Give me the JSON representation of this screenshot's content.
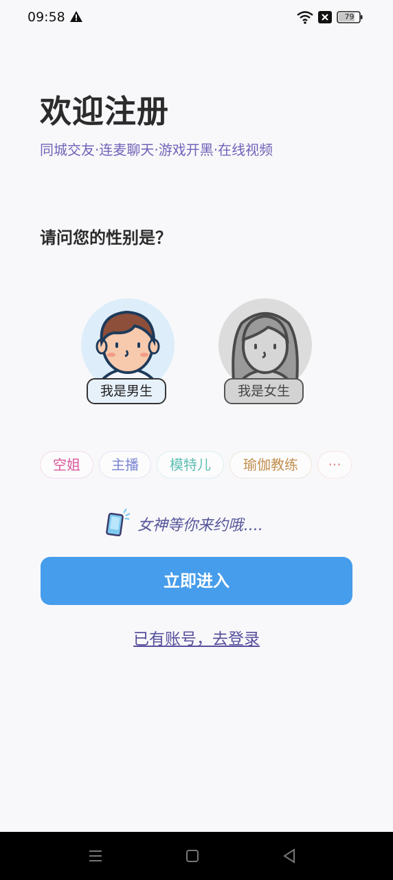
{
  "status_bar": {
    "time": "09:58",
    "battery": "79",
    "icons": [
      "warning-icon",
      "wifi-icon",
      "no-sim-icon",
      "battery-icon"
    ]
  },
  "header": {
    "title": "欢迎注册",
    "subtitle": "同城交友·连麦聊天·游戏开黑·在线视频"
  },
  "gender": {
    "question": "请问您的性别是？",
    "male_label": "我是男生",
    "female_label": "我是女生"
  },
  "tags": [
    {
      "label": "空姐",
      "color": "#d9559a"
    },
    {
      "label": "主播",
      "color": "#7b86d3"
    },
    {
      "label": "模特儿",
      "color": "#5fc0b3"
    },
    {
      "label": "瑜伽教练",
      "color": "#c28f4f"
    },
    {
      "label": "···",
      "color": "#e08a80"
    }
  ],
  "hint": {
    "text": "女神等你来约哦...."
  },
  "actions": {
    "enter_label": "立即进入",
    "login_label": "已有账号，去登录"
  },
  "colors": {
    "accent": "#469deb",
    "subtitle": "#6f63b8",
    "link": "#564f9d"
  },
  "nav_bar": {
    "icons": [
      "menu-icon",
      "home-icon",
      "back-icon"
    ]
  }
}
